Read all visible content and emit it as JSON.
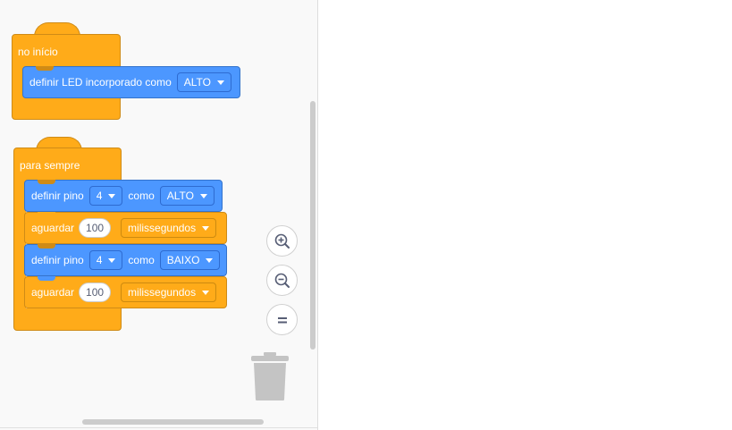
{
  "workspace": {
    "setup_script": {
      "hat_label": "no início",
      "blocks": [
        {
          "text": "definir LED incorporado como",
          "dropdown": "ALTO"
        }
      ]
    },
    "loop_script": {
      "hat_label": "para sempre",
      "blocks": [
        {
          "label1": "definir pino",
          "pin": "4",
          "label2": "como",
          "value": "ALTO"
        },
        {
          "label": "aguardar",
          "amount": "100",
          "unit": "milissegundos"
        },
        {
          "label1": "definir pino",
          "pin": "4",
          "label2": "como",
          "value": "BAIXO"
        },
        {
          "label": "aguardar",
          "amount": "100",
          "unit": "milissegundos"
        }
      ]
    }
  },
  "zoom_controls": {
    "icons": [
      "zoom-in-icon",
      "zoom-out-icon",
      "zoom-reset-icon"
    ]
  },
  "trash": {
    "icon": "trash-icon"
  },
  "colors": {
    "control_orange": "#ffab19",
    "control_orange_border": "#cf8b17",
    "io_blue": "#4c97ff",
    "io_blue_border": "#3373cc",
    "workspace_bg": "#f9f9f9",
    "icon_gray": "#575e75"
  }
}
